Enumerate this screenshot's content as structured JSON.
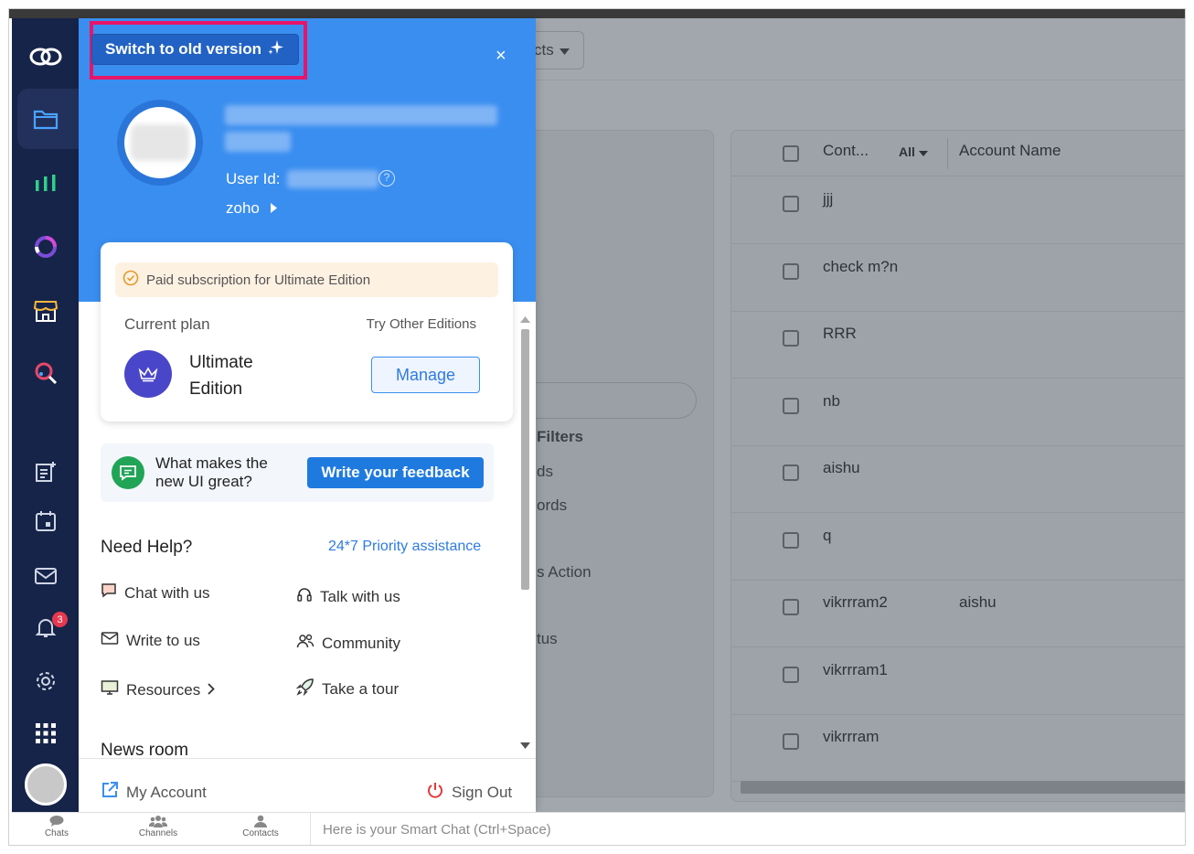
{
  "colors": {
    "rail_bg": "#172449",
    "panel_header": "#3a8ef0",
    "accent": "#1f7ae0",
    "highlight": "#e8146a",
    "badge": "#e53950"
  },
  "rail": {
    "notification_count": "3",
    "icons": [
      "zoho-logo-icon",
      "folder-icon",
      "analytics-icon",
      "ring-chart-icon",
      "store-icon",
      "search-icon",
      "notes-add-icon",
      "calendar-icon",
      "mail-icon",
      "bell-icon",
      "gear-icon",
      "apps-grid-icon"
    ]
  },
  "background": {
    "view_dropdown": "cts",
    "filters_heading": "Filters",
    "filter_items": [
      "ds",
      "ords",
      "s Action",
      "tus"
    ],
    "table": {
      "columns": [
        "Cont...",
        "All",
        "Account Name"
      ],
      "rows": [
        {
          "contact": "jjj",
          "account": ""
        },
        {
          "contact": "check m?n",
          "account": ""
        },
        {
          "contact": "RRR",
          "account": ""
        },
        {
          "contact": "nb",
          "account": ""
        },
        {
          "contact": "aishu",
          "account": ""
        },
        {
          "contact": "q",
          "account": ""
        },
        {
          "contact": "vikrrram2",
          "account": "aishu"
        },
        {
          "contact": "vikrrram1",
          "account": ""
        },
        {
          "contact": "vikrrram",
          "account": ""
        }
      ]
    }
  },
  "panel": {
    "switch_label": "Switch to old version",
    "close_label": "×",
    "user_id_label": "User Id:",
    "org_name": "zoho",
    "plan": {
      "paid_banner": "Paid subscription for Ultimate Edition",
      "current_plan_label": "Current plan",
      "try_other_label": "Try Other Editions",
      "edition_name": "Ultimate Edition",
      "manage_label": "Manage"
    },
    "feedback": {
      "prompt": "What makes the new UI great?",
      "button": "Write your feedback"
    },
    "help": {
      "title": "Need Help?",
      "priority_link": "24*7 Priority assistance",
      "chat": "Chat with us",
      "talk": "Talk with us",
      "write": "Write to us",
      "community": "Community",
      "resources": "Resources",
      "tour": "Take a tour"
    },
    "news_title": "News room",
    "footer": {
      "my_account": "My Account",
      "sign_out": "Sign Out"
    }
  },
  "bottombar": {
    "chats": "Chats",
    "channels": "Channels",
    "contacts": "Contacts",
    "smart_chat_placeholder": "Here is your Smart Chat (Ctrl+Space)"
  }
}
